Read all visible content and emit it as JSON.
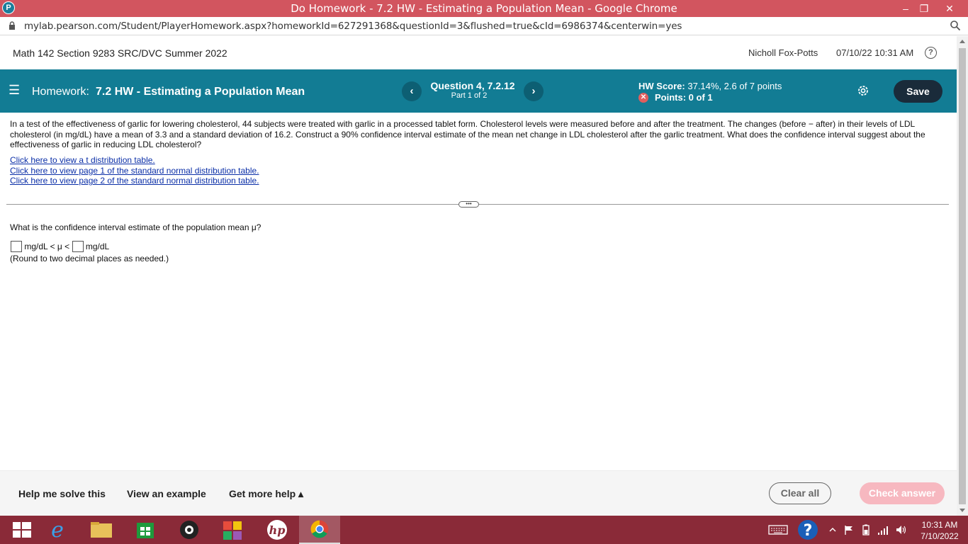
{
  "window": {
    "title": "Do Homework - 7.2 HW - Estimating a Population Mean - Google Chrome",
    "logo_letter": "P",
    "minimize": "–",
    "restore": "❐",
    "close": "✕"
  },
  "browser": {
    "url": "mylab.pearson.com/Student/PlayerHomework.aspx?homeworkId=627291368&questionId=3&flushed=true&cId=6986374&centerwin=yes"
  },
  "course": {
    "name": "Math 142 Section 9283 SRC/DVC Summer 2022",
    "user": "Nicholl Fox-Potts",
    "datetime": "07/10/22 10:31 AM",
    "help": "?"
  },
  "homework": {
    "menu_glyph": "☰",
    "label": "Homework:",
    "title": "7.2 HW - Estimating a Population Mean",
    "prev": "‹",
    "next": "›",
    "question": "Question 4, 7.2.12",
    "part": "Part 1 of 2",
    "score_label": "HW Score:",
    "score_value": "37.14%, 2.6 of 7 points",
    "points": "Points: 0 of 1",
    "points_icon": "✕",
    "save": "Save"
  },
  "problem": {
    "text": "In a test of the effectiveness of garlic for lowering cholesterol, 44 subjects were treated with garlic in a processed tablet form. Cholesterol levels were measured before and after the treatment. The changes (before − after) in their levels of LDL cholesterol (in mg/dL) have a mean of 3.3 and a standard deviation of 16.2. Construct a 90% confidence interval estimate of the mean net change in LDL cholesterol after the garlic treatment. What does the confidence interval suggest about the effectiveness of garlic in reducing LDL cholesterol?",
    "links": [
      "Click here to view a t distribution table.",
      "Click here to view page 1 of the standard normal distribution table.",
      "Click here to view page 2 of the standard normal distribution table."
    ],
    "divider_handle": "•••",
    "question": "What is the confidence interval estimate of the population mean μ?",
    "unit_left": "mg/dL < μ <",
    "unit_right": "mg/dL",
    "note": "(Round to two decimal places as needed.)"
  },
  "footer": {
    "help_solve": "Help me solve this",
    "example": "View an example",
    "more_help": "Get more help ▴",
    "clear_all": "Clear all",
    "check_answer": "Check answer"
  },
  "taskbar": {
    "time": "10:31 AM",
    "date": "7/10/2022"
  },
  "colors": {
    "title_bar": "#d2555f",
    "homework_bar": "#127c94",
    "save_button": "#1a2b3a",
    "check_button": "#f7b8c0",
    "taskbar": "#8a2a38",
    "link": "#0a2ea7"
  }
}
